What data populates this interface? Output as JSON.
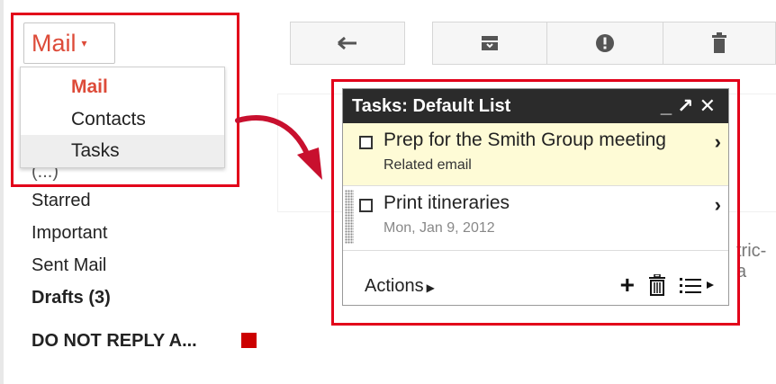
{
  "mail_switcher": {
    "label": "Mail",
    "caret": "▾",
    "menu": [
      "Mail",
      "Contacts",
      "Tasks"
    ]
  },
  "toolbar": {
    "reply_icon": "reply-icon",
    "archive_icon": "archive-icon",
    "spam_icon": "report-spam-icon",
    "delete_icon": "trash-icon"
  },
  "nav": {
    "partial": "(...)",
    "starred": "Starred",
    "important": "Important",
    "sent": "Sent Mail",
    "drafts": "Drafts (3)",
    "label": "DO NOT REPLY A...",
    "label_color": "#cc0000"
  },
  "tasks": {
    "title": "Tasks: Default List",
    "items": [
      {
        "title": "Prep for the Smith Group meeting",
        "sub": "Related email"
      },
      {
        "title": "Print itineraries",
        "sub": "Mon, Jan 9, 2012"
      }
    ],
    "actions": "Actions"
  },
  "ghost_text": "tric-a",
  "colors": {
    "highlight": "#e2001a",
    "accent": "#dd4b39"
  }
}
